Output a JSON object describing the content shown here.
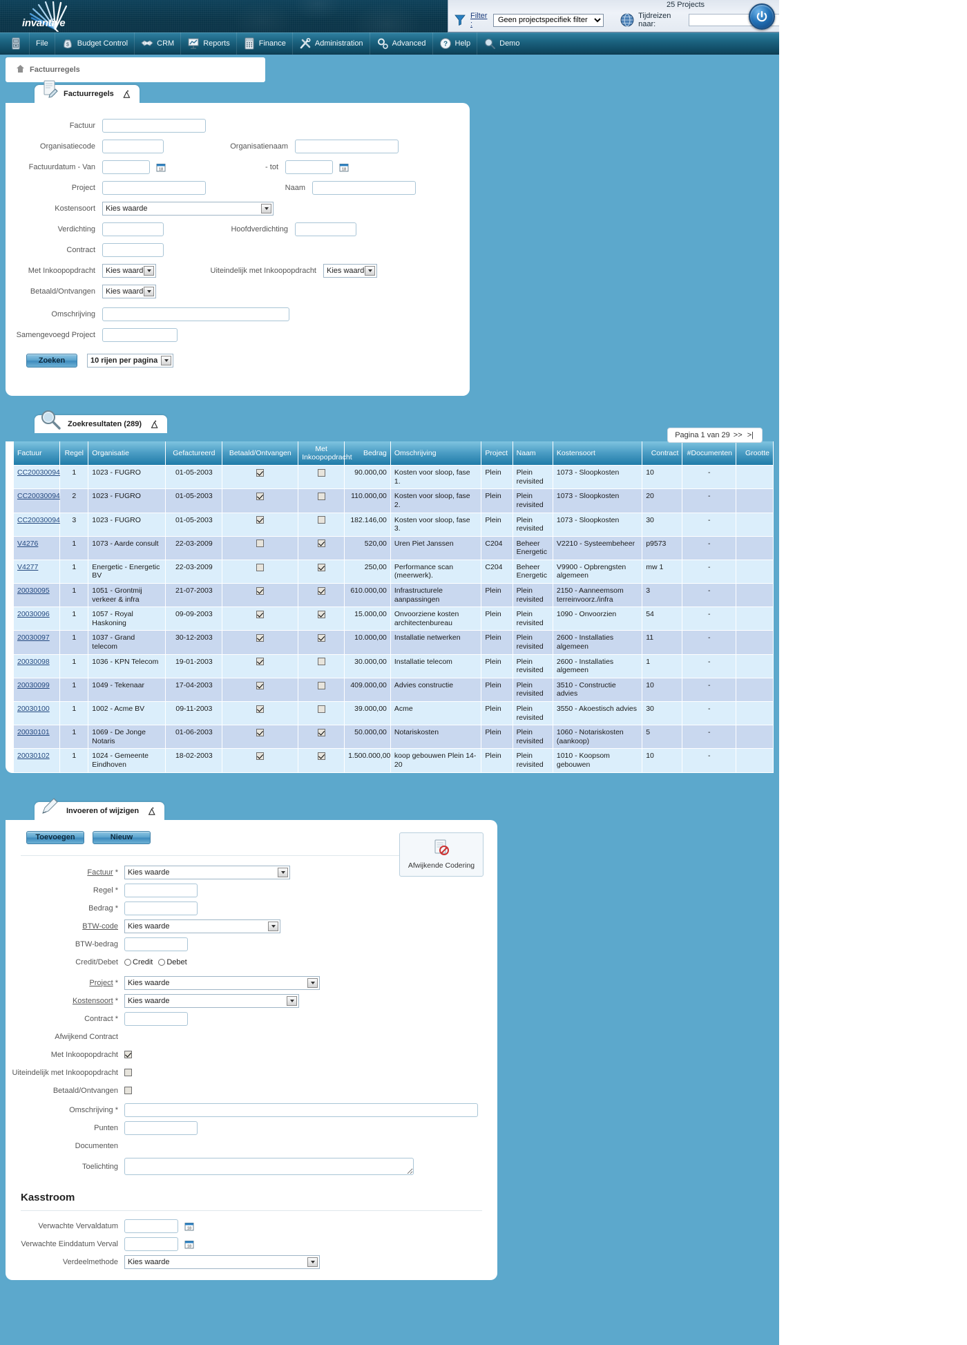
{
  "app": {
    "logo_text": "invantive",
    "project_count": "25 Projects"
  },
  "topbar": {
    "funnel_icon": "funnel-icon",
    "filter_label": "Filter :",
    "filter_value": "Geen projectspecifiek filter",
    "globe_icon": "globe-icon",
    "tijdreizen_label": "Tijdreizen naar:",
    "tijdreizen_value": "",
    "power_icon": "power-icon"
  },
  "menu": [
    {
      "label": "File",
      "icon": "file-cabinet-icon"
    },
    {
      "label": "Budget Control",
      "icon": "money-bag-icon"
    },
    {
      "label": "CRM",
      "icon": "handshake-icon"
    },
    {
      "label": "Reports",
      "icon": "presentation-chart-icon"
    },
    {
      "label": "Finance",
      "icon": "calculator-icon"
    },
    {
      "label": "Administration",
      "icon": "tools-icon"
    },
    {
      "label": "Advanced",
      "icon": "gears-icon"
    },
    {
      "label": "Help",
      "icon": "question-mark-icon"
    },
    {
      "label": "Demo",
      "icon": "magnifier-person-icon"
    }
  ],
  "breadcrumb": {
    "home_icon": "home-icon",
    "text": "Factuurregels"
  },
  "search_panel": {
    "tab_label": "Factuurregels",
    "tab_icon": "document-edit-icon",
    "collapse_icon": "chevron-up-icon",
    "labels": {
      "factuur": "Factuur",
      "organisatiecode": "Organisatiecode",
      "organisatienaam": "Organisatienaam",
      "factuurdatum_van": "Factuurdatum - Van",
      "tot": "- tot",
      "project": "Project",
      "naam": "Naam",
      "kostensoort": "Kostensoort",
      "verdichting": "Verdichting",
      "hoofdverdichting": "Hoofdverdichting",
      "contract": "Contract",
      "met_inkoopopdracht": "Met Inkoopopdracht",
      "uiteindelijk_met_inkoopopdracht": "Uiteindelijk met Inkoopopdracht",
      "betaald_ontvangen": "Betaald/Ontvangen",
      "omschrijving": "Omschrijving",
      "samengevoegd_project": "Samengevoegd Project"
    },
    "values": {
      "factuur": "",
      "organisatiecode": "",
      "organisatienaam": "",
      "factuurdatum_van": "",
      "factuurdatum_tot": "",
      "project": "",
      "naam": "",
      "kostensoort": "Kies waarde",
      "verdichting": "",
      "hoofdverdichting": "",
      "contract": "",
      "met_inkoopopdracht": "Kies waarde",
      "uiteindelijk_met_inkoopopdracht": "Kies waarde",
      "betaald_ontvangen": "Kies waarde",
      "omschrijving": "",
      "samengevoegd_project": ""
    },
    "search_button": "Zoeken",
    "rows_per_page": "10 rijen per pagina",
    "calendar_icon": "calendar-icon"
  },
  "results": {
    "tab_label": "Zoekresultaten (289)",
    "tab_icon": "magnifier-icon",
    "collapse_icon": "chevron-up-icon",
    "pager": {
      "page_text": "Pagina 1 van 29",
      "next": ">>",
      "last": ">|"
    },
    "columns": [
      "Factuur",
      "Regel",
      "Organisatie",
      "Gefactureerd",
      "Betaald/Ontvangen",
      "Met Inkoopopdracht",
      "Bedrag",
      "Omschrijving",
      "Project",
      "Naam",
      "Kostensoort",
      "Contract",
      "#Documenten",
      "Grootte"
    ],
    "rows": [
      {
        "factuur": "CC20030094",
        "regel": "1",
        "organisatie": "1023 - FUGRO",
        "gefactureerd": "01-05-2003",
        "betaald": true,
        "inkoop": false,
        "bedrag": "90.000,00",
        "omschrijving": "Kosten voor sloop, fase 1.",
        "project": "Plein",
        "naam": "Plein revisited",
        "kostensoort": "1073 - Sloopkosten",
        "contract": "10",
        "documenten": "-",
        "grootte": ""
      },
      {
        "factuur": "CC20030094",
        "regel": "2",
        "organisatie": "1023 - FUGRO",
        "gefactureerd": "01-05-2003",
        "betaald": true,
        "inkoop": false,
        "bedrag": "110.000,00",
        "omschrijving": "Kosten voor sloop, fase 2.",
        "project": "Plein",
        "naam": "Plein revisited",
        "kostensoort": "1073 - Sloopkosten",
        "contract": "20",
        "documenten": "-",
        "grootte": ""
      },
      {
        "factuur": "CC20030094",
        "regel": "3",
        "organisatie": "1023 - FUGRO",
        "gefactureerd": "01-05-2003",
        "betaald": true,
        "inkoop": false,
        "bedrag": "182.146,00",
        "omschrijving": "Kosten voor sloop, fase 3.",
        "project": "Plein",
        "naam": "Plein revisited",
        "kostensoort": "1073 - Sloopkosten",
        "contract": "30",
        "documenten": "-",
        "grootte": ""
      },
      {
        "factuur": "V4276",
        "regel": "1",
        "organisatie": "1073 - Aarde consult",
        "gefactureerd": "22-03-2009",
        "betaald": false,
        "inkoop": true,
        "bedrag": "520,00",
        "omschrijving": "Uren Piet Janssen",
        "project": "C204",
        "naam": "Beheer Energetic",
        "kostensoort": "V2210 - Systeembeheer",
        "contract": "p9573",
        "documenten": "-",
        "grootte": ""
      },
      {
        "factuur": "V4277",
        "regel": "1",
        "organisatie": "Energetic - Energetic BV",
        "gefactureerd": "22-03-2009",
        "betaald": false,
        "inkoop": true,
        "bedrag": "250,00",
        "omschrijving": "Performance scan (meerwerk).",
        "project": "C204",
        "naam": "Beheer Energetic",
        "kostensoort": "V9900 - Opbrengsten algemeen",
        "contract": "mw 1",
        "documenten": "-",
        "grootte": ""
      },
      {
        "factuur": "20030095",
        "regel": "1",
        "organisatie": "1051 - Grontmij verkeer & infra",
        "gefactureerd": "21-07-2003",
        "betaald": true,
        "inkoop": true,
        "bedrag": "610.000,00",
        "omschrijving": "Infrastructurele aanpassingen",
        "project": "Plein",
        "naam": "Plein revisited",
        "kostensoort": "2150 - Aanneemsom terreinvoorz./infra",
        "contract": "3",
        "documenten": "-",
        "grootte": ""
      },
      {
        "factuur": "20030096",
        "regel": "1",
        "organisatie": "1057 - Royal Haskoning",
        "gefactureerd": "09-09-2003",
        "betaald": true,
        "inkoop": true,
        "bedrag": "15.000,00",
        "omschrijving": "Onvoorziene kosten architectenbureau",
        "project": "Plein",
        "naam": "Plein revisited",
        "kostensoort": "1090 - Onvoorzien",
        "contract": "54",
        "documenten": "-",
        "grootte": ""
      },
      {
        "factuur": "20030097",
        "regel": "1",
        "organisatie": "1037 - Grand telecom",
        "gefactureerd": "30-12-2003",
        "betaald": true,
        "inkoop": true,
        "bedrag": "10.000,00",
        "omschrijving": "Installatie netwerken",
        "project": "Plein",
        "naam": "Plein revisited",
        "kostensoort": "2600 - Installaties algemeen",
        "contract": "11",
        "documenten": "-",
        "grootte": ""
      },
      {
        "factuur": "20030098",
        "regel": "1",
        "organisatie": "1036 - KPN Telecom",
        "gefactureerd": "19-01-2003",
        "betaald": true,
        "inkoop": false,
        "bedrag": "30.000,00",
        "omschrijving": "Installatie telecom",
        "project": "Plein",
        "naam": "Plein revisited",
        "kostensoort": "2600 - Installaties algemeen",
        "contract": "1",
        "documenten": "-",
        "grootte": ""
      },
      {
        "factuur": "20030099",
        "regel": "1",
        "organisatie": "1049 - Tekenaar",
        "gefactureerd": "17-04-2003",
        "betaald": true,
        "inkoop": false,
        "bedrag": "409.000,00",
        "omschrijving": "Advies constructie",
        "project": "Plein",
        "naam": "Plein revisited",
        "kostensoort": "3510 - Constructie advies",
        "contract": "10",
        "documenten": "-",
        "grootte": ""
      },
      {
        "factuur": "20030100",
        "regel": "1",
        "organisatie": "1002 - Acme BV",
        "gefactureerd": "09-11-2003",
        "betaald": true,
        "inkoop": false,
        "bedrag": "39.000,00",
        "omschrijving": "Acme",
        "project": "Plein",
        "naam": "Plein revisited",
        "kostensoort": "3550 - Akoestisch advies",
        "contract": "30",
        "documenten": "-",
        "grootte": ""
      },
      {
        "factuur": "20030101",
        "regel": "1",
        "organisatie": "1069 - De Jonge Notaris",
        "gefactureerd": "01-06-2003",
        "betaald": true,
        "inkoop": true,
        "bedrag": "50.000,00",
        "omschrijving": "Notariskosten",
        "project": "Plein",
        "naam": "Plein revisited",
        "kostensoort": "1060 - Notariskosten (aankoop)",
        "contract": "5",
        "documenten": "-",
        "grootte": ""
      },
      {
        "factuur": "20030102",
        "regel": "1",
        "organisatie": "1024 - Gemeente Eindhoven",
        "gefactureerd": "18-02-2003",
        "betaald": true,
        "inkoop": true,
        "bedrag": "1.500.000,00",
        "omschrijving": "koop gebouwen Plein 14-20",
        "project": "Plein",
        "naam": "Plein revisited",
        "kostensoort": "1010 - Koopsom gebouwen",
        "contract": "10",
        "documenten": "-",
        "grootte": ""
      }
    ]
  },
  "edit_panel": {
    "tab_label": "Invoeren of wijzigen",
    "tab_icon": "pen-icon",
    "collapse_icon": "chevron-up-icon",
    "buttons": {
      "add": "Toevoegen",
      "new": "Nieuw"
    },
    "coding_box": {
      "label": "Afwijkende Codering",
      "icon": "coding-document-icon"
    },
    "labels": {
      "factuur": "Factuur",
      "regel": "Regel",
      "bedrag": "Bedrag",
      "btw_code": "BTW-code",
      "btw_bedrag": "BTW-bedrag",
      "credit_debet": "Credit/Debet",
      "project": "Project",
      "kostensoort": "Kostensoort",
      "contract": "Contract",
      "afwijkend_contract": "Afwijkend Contract",
      "met_inkoopopdracht": "Met Inkoopopdracht",
      "uiteindelijk_met_inkoopopdracht": "Uiteindelijk met Inkoopopdracht",
      "betaald_ontvangen": "Betaald/Ontvangen",
      "omschrijving": "Omschrijving",
      "punten": "Punten",
      "documenten": "Documenten",
      "toelichting": "Toelichting"
    },
    "values": {
      "factuur": "Kies waarde",
      "regel": "",
      "bedrag": "",
      "btw_code": "Kies waarde",
      "btw_bedrag": "",
      "credit_label": "Credit",
      "debet_label": "Debet",
      "project": "Kies waarde",
      "kostensoort": "Kies waarde",
      "contract": "",
      "met_inkoopopdracht": true,
      "uiteindelijk_met_inkoopopdracht": false,
      "betaald_ontvangen": false,
      "omschrijving": "",
      "punten": "",
      "toelichting": ""
    },
    "required_marker": "*",
    "kasstroom": {
      "title": "Kasstroom",
      "labels": {
        "verwachte_vervaldatum": "Verwachte Vervaldatum",
        "verwachte_einddatum_verval": "Verwachte Einddatum Verval",
        "verdeelmethode": "Verdeelmethode"
      },
      "values": {
        "verwachte_vervaldatum": "",
        "verwachte_einddatum_verval": "",
        "verdeelmethode": "Kies waarde"
      },
      "calendar_icon": "calendar-icon"
    }
  },
  "colors": {
    "page_bg": "#5ca8cc",
    "banner": "#0d4059",
    "menu": "#1d6683",
    "grid_header": "#1f7ba8",
    "row_odd": "#dbeefb",
    "row_even": "#c9d8ef",
    "accent_button": "#5ea6cf"
  }
}
